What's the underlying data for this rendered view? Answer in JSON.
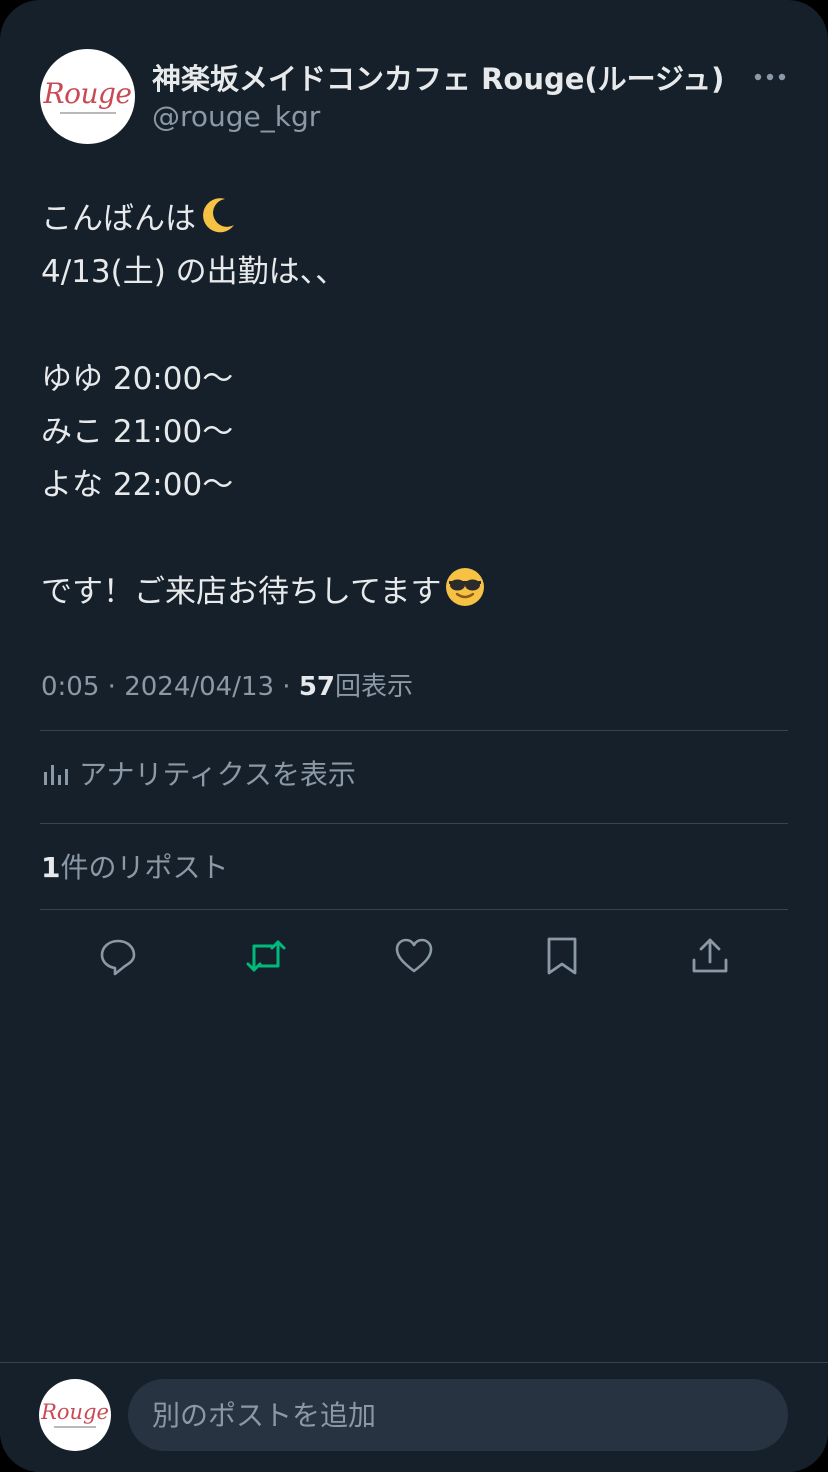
{
  "post": {
    "author": {
      "display_name": "神楽坂メイドコンカフェ Rouge(ルージュ)",
      "handle": "@rouge_kgr",
      "avatar_logo": "Rouge"
    },
    "text_lines": [
      "こんばんは",
      "4/13(土) の出勤は、、",
      "",
      "ゆゆ 20:00〜",
      "みこ 21:00〜",
      "よな 22:00〜",
      "",
      "です！ご来店お待ちしてます"
    ],
    "emojis": [
      "crescent-moon-icon",
      "sunglasses-face-icon"
    ],
    "time": "0:05",
    "date": "2024/04/13",
    "sep": " · ",
    "views_count": "57",
    "views_label": "回表示",
    "analytics_label": "アナリティクスを表示",
    "repost_count": "1",
    "repost_label": "件のリポスト"
  },
  "actions": [
    {
      "name": "reply-icon"
    },
    {
      "name": "repost-icon",
      "color": "#00ba7c"
    },
    {
      "name": "like-icon"
    },
    {
      "name": "bookmark-icon"
    },
    {
      "name": "share-icon"
    }
  ],
  "composer": {
    "placeholder": "別のポストを追加",
    "avatar_logo": "Rouge"
  },
  "colors": {
    "background": "#15202b",
    "text": "#e7e9ea",
    "muted": "#8b98a5",
    "divider": "#38444d",
    "repost_accent": "#00ba7c",
    "input_bg": "#273340"
  }
}
